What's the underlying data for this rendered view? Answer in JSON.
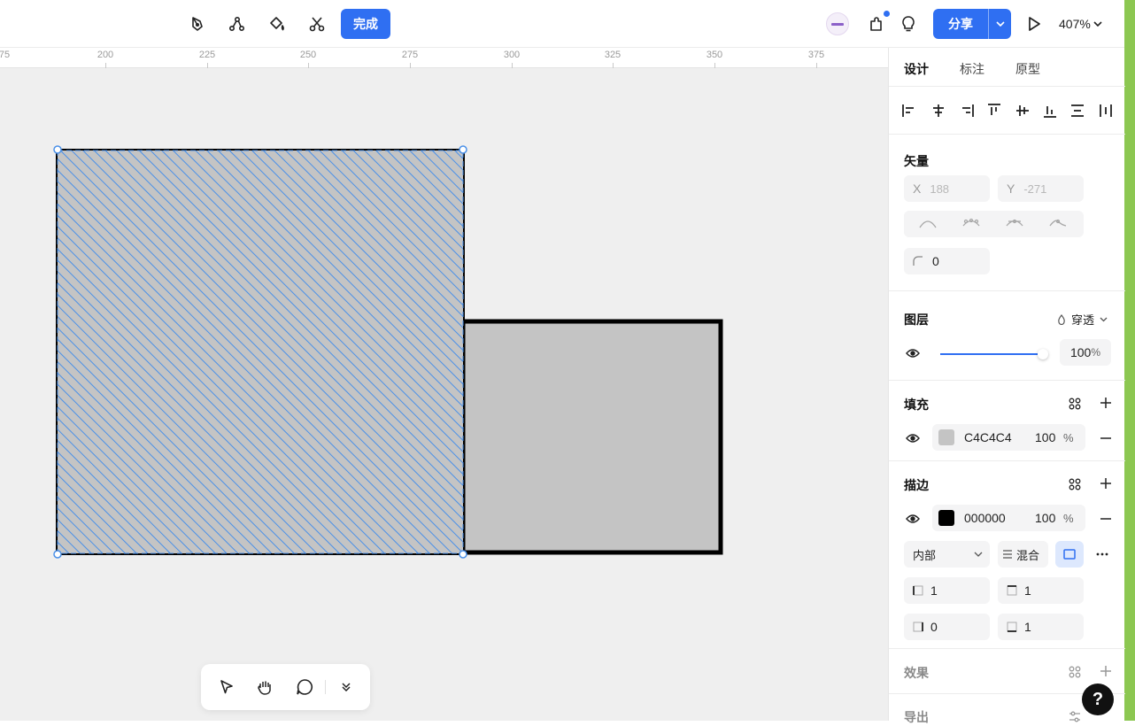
{
  "toolbar": {
    "done_label": "完成",
    "share_label": "分享",
    "zoom": "407%"
  },
  "ruler": {
    "ticks": [
      "75",
      "200",
      "225",
      "250",
      "275",
      "300",
      "325",
      "350",
      "375"
    ]
  },
  "panel": {
    "tabs": [
      "设计",
      "标注",
      "原型"
    ],
    "vector": {
      "title": "矢量",
      "x_label": "X",
      "x_value": "188",
      "y_label": "Y",
      "y_value": "-271",
      "corner_value": "0"
    },
    "layer": {
      "title": "图层",
      "blend_mode": "穿透",
      "opacity": "100",
      "opacity_unit": "%",
      "opacity_fraction": 1.0
    },
    "fill": {
      "title": "填充",
      "hex": "C4C4C4",
      "color": "#C4C4C4",
      "opacity": "100",
      "unit": "%"
    },
    "stroke": {
      "title": "描边",
      "hex": "000000",
      "color": "#000000",
      "opacity": "100",
      "unit": "%",
      "position": "内部",
      "mix_label": "混合",
      "left": "1",
      "top": "1",
      "right": "0",
      "bottom": "1"
    },
    "effects": {
      "title": "效果"
    },
    "export": {
      "title": "导出"
    }
  },
  "help_label": "?",
  "colors": {
    "accent": "#2f6ff2",
    "selection": "#4a90e8",
    "shape_fill": "#c4c4c4"
  }
}
